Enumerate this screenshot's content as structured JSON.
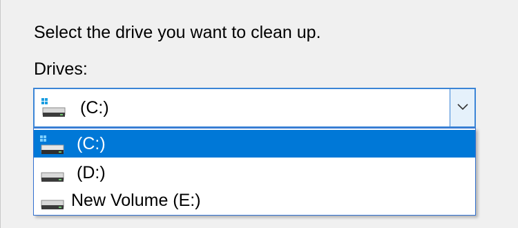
{
  "dialog": {
    "instruction": "Select the drive you want to clean up.",
    "drives_label": "Drives:"
  },
  "combo": {
    "selected_value": "(C:)",
    "selected_icon": "windows-system-drive-icon",
    "arrow_icon": "chevron-down-icon"
  },
  "dropdown": {
    "options": [
      {
        "label": "(C:)",
        "icon": "windows-system-drive-icon",
        "selected": true
      },
      {
        "label": "(D:)",
        "icon": "drive-icon",
        "selected": false
      },
      {
        "label": "New Volume (E:)",
        "icon": "drive-icon",
        "selected": false
      }
    ]
  },
  "colors": {
    "selection": "#0078d7",
    "focus_border": "#3a84d6",
    "background": "#f0f0f0"
  }
}
